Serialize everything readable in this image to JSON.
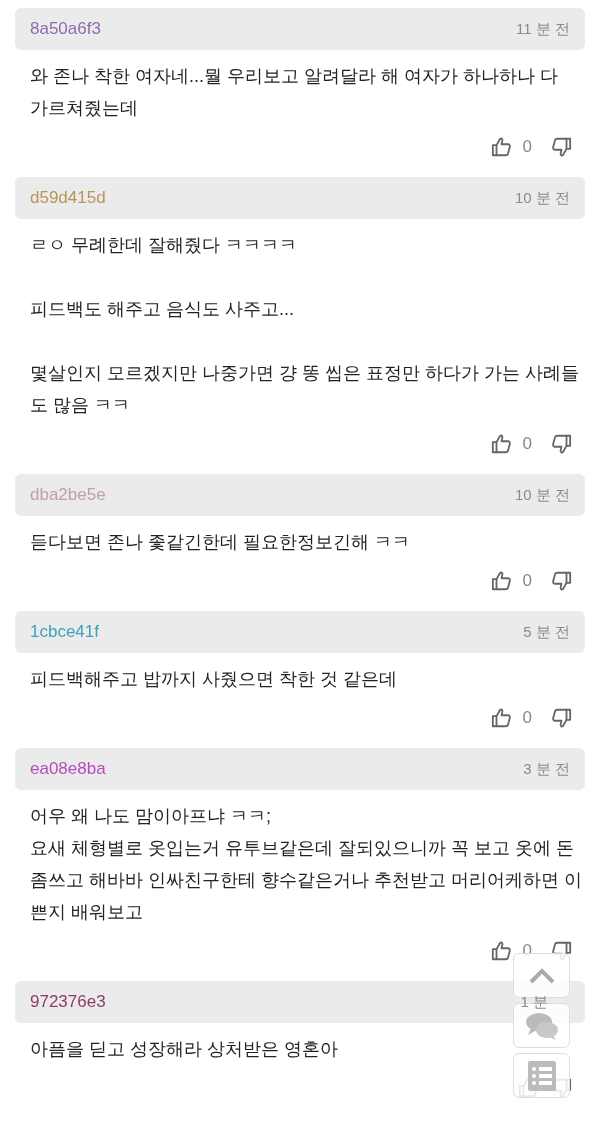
{
  "comments": [
    {
      "user": "8a50a6f3",
      "color": "#8f6aae",
      "time": "11 분 전",
      "body": "와 존나 착한 여자네...뭘 우리보고 알려달라 해 여자가 하나하나 다\n가르쳐줬는데",
      "likes": "0"
    },
    {
      "user": "d59d415d",
      "color": "#b9955a",
      "time": "10 분 전",
      "body": "ㄹㅇ 무례한데 잘해줬다 ㅋㅋㅋㅋ\n\n피드백도 해주고 음식도 사주고...\n\n몇살인지 모르겠지만 나중가면 걍 똥 씹은 표정만 하다가 가는 사례들\n도 많음 ㅋㅋ",
      "likes": "0"
    },
    {
      "user": "dba2be5e",
      "color": "#c49bb5",
      "time": "10 분 전",
      "body": "듣다보면 존나 좇같긴한데 필요한정보긴해 ㅋㅋ",
      "likes": "0"
    },
    {
      "user": "1cbce41f",
      "color": "#3ba3b8",
      "time": "5 분 전",
      "body": "피드백해주고 밥까지 사줬으면 착한 것 같은데",
      "likes": "0"
    },
    {
      "user": "ea08e8ba",
      "color": "#b64cbf",
      "time": "3 분 전",
      "body": "어우 왜 나도 맘이아프냐 ㅋㅋ;\n요새 체형별로 옷입는거 유투브같은데 잘되있으니까 꼭 보고 옷에 돈\n좀쓰고 해바바 인싸친구한테 향수같은거나 추천받고 머리어케하면 이\n쁜지 배워보고",
      "likes": "0"
    },
    {
      "user": "972376e3",
      "color": "#8e3b6b",
      "time": "1 분",
      "body": "아픔을 딛고 성장해라 상처받은 영혼아"
    }
  ],
  "floating_buttons": [
    {
      "kind": "top"
    },
    {
      "kind": "comments"
    },
    {
      "kind": "list"
    }
  ]
}
